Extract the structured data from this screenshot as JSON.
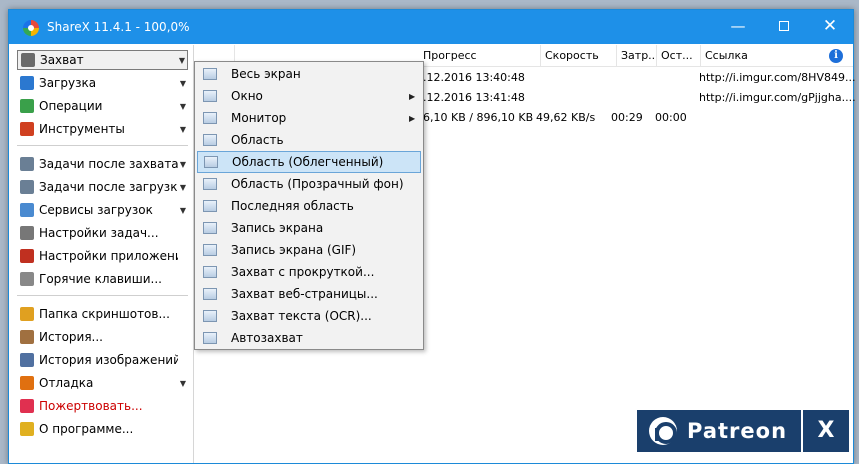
{
  "window": {
    "title": "ShareX 11.4.1 - 100,0%"
  },
  "sidebar": {
    "items": [
      {
        "label": "Захват",
        "arrow": true,
        "icon_color": "#6a6a6a"
      },
      {
        "label": "Загрузка",
        "arrow": true,
        "icon_color": "#2b78d0"
      },
      {
        "label": "Операции",
        "arrow": true,
        "icon_color": "#3aa04a"
      },
      {
        "label": "Инструменты",
        "arrow": true,
        "icon_color": "#d04020"
      },
      {
        "label": "Задачи после захвата",
        "arrow": true,
        "icon_color": "#6a7f95"
      },
      {
        "label": "Задачи после загрузки",
        "arrow": true,
        "icon_color": "#6a7f95"
      },
      {
        "label": "Сервисы загрузок",
        "arrow": true,
        "icon_color": "#4a8ad0"
      },
      {
        "label": "Настройки задач...",
        "arrow": false,
        "icon_color": "#777777"
      },
      {
        "label": "Настройки приложения...",
        "arrow": false,
        "icon_color": "#c03020"
      },
      {
        "label": "Горячие клавиши...",
        "arrow": false,
        "icon_color": "#888888"
      },
      {
        "label": "Папка скриншотов...",
        "arrow": false,
        "icon_color": "#e0a020"
      },
      {
        "label": "История...",
        "arrow": false,
        "icon_color": "#a07040"
      },
      {
        "label": "История изображений...",
        "arrow": false,
        "icon_color": "#5070a0"
      },
      {
        "label": "Отладка",
        "arrow": true,
        "icon_color": "#e07010"
      },
      {
        "label": "Пожертвовать...",
        "arrow": false,
        "icon_color": "#e03050"
      },
      {
        "label": "О программе...",
        "arrow": false,
        "icon_color": "#e0b020"
      }
    ]
  },
  "table": {
    "columns": [
      "Прогресс",
      "Скорость",
      "Затр...",
      "Ост...",
      "Ссылка"
    ],
    "rows": [
      {
        "progress": "4.12.2016 13:40:48",
        "speed": "",
        "elapsed": "",
        "remaining": "",
        "link": "http://i.imgur.com/8HV849..."
      },
      {
        "progress": "4.12.2016 13:41:48",
        "speed": "",
        "elapsed": "",
        "remaining": "",
        "link": "http://i.imgur.com/gPjjgha...."
      },
      {
        "progress": "96,10 KB / 896,10 KB",
        "speed": "49,62 KB/s",
        "elapsed": "00:29",
        "remaining": "00:00",
        "link": ""
      }
    ]
  },
  "capture_menu": {
    "items": [
      {
        "label": "Весь экран",
        "arrow": false
      },
      {
        "label": "Окно",
        "arrow": true
      },
      {
        "label": "Монитор",
        "arrow": true
      },
      {
        "label": "Область",
        "arrow": false
      },
      {
        "label": "Область (Облегченный)",
        "arrow": false,
        "highlighted": true
      },
      {
        "label": "Область (Прозрачный фон)",
        "arrow": false
      },
      {
        "label": "Последняя область",
        "arrow": false
      },
      {
        "label": "Запись экрана",
        "arrow": false
      },
      {
        "label": "Запись экрана (GIF)",
        "arrow": false
      },
      {
        "label": "Захват с прокруткой...",
        "arrow": false
      },
      {
        "label": "Захват веб-страницы...",
        "arrow": false
      },
      {
        "label": "Захват текста (OCR)...",
        "arrow": false
      },
      {
        "label": "Автозахват",
        "arrow": false
      }
    ]
  },
  "patreon": {
    "text": "Patreon",
    "x": "X"
  },
  "colors": {
    "titlebar": "#1e90e8",
    "highlight": "#cce4f7",
    "patreon_bg": "#1a3f6c",
    "donate": "#cc0000"
  }
}
